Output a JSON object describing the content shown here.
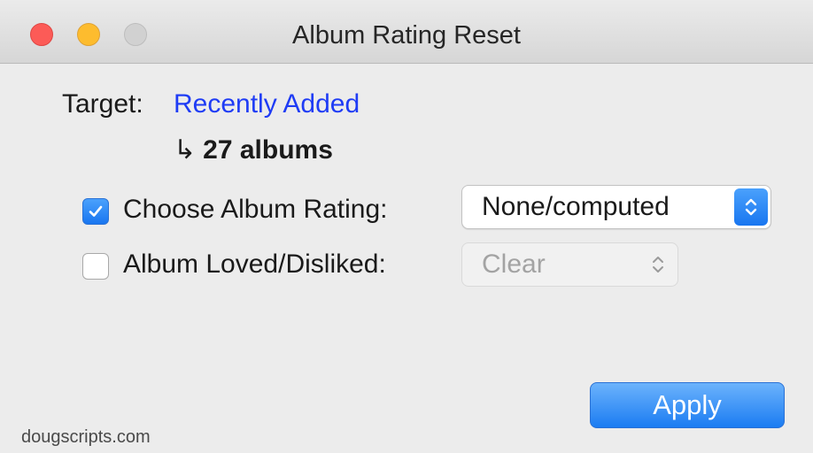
{
  "window": {
    "title": "Album Rating Reset"
  },
  "target": {
    "label": "Target:",
    "value": "Recently Added",
    "result_arrow": "↳",
    "result_count": "27 albums"
  },
  "options": {
    "rating": {
      "checked": true,
      "label": "Choose Album Rating:",
      "selected": "None/computed"
    },
    "loved": {
      "checked": false,
      "label": "Album Loved/Disliked:",
      "selected": "Clear"
    }
  },
  "actions": {
    "apply_label": "Apply"
  },
  "footer": {
    "credit": "dougscripts.com"
  },
  "icons": {
    "checkmark": "checkmark-icon",
    "stepper": "up-down-chevron-icon"
  },
  "colors": {
    "link": "#1f3cf5",
    "accent": "#1976f0",
    "close": "#fc5b57",
    "minimize": "#fdbc2e",
    "zoom_disabled": "#d1d1d1"
  }
}
